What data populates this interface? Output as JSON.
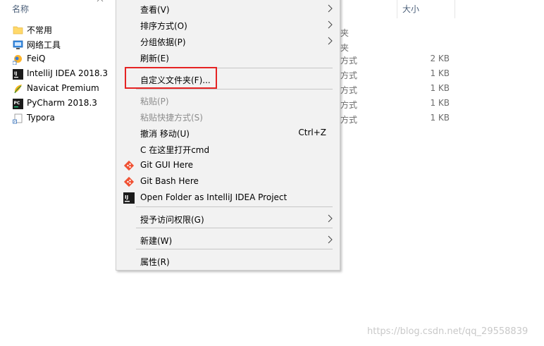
{
  "explorer": {
    "columns": {
      "name": "名称",
      "size": "大小"
    },
    "files": [
      {
        "name": "不常用",
        "icon": "folder-icon",
        "type": "",
        "size": ""
      },
      {
        "name": "网络工具",
        "icon": "network-tools-icon",
        "type": "",
        "size": ""
      },
      {
        "name": "FeiQ",
        "icon": "feiq-shortcut-icon",
        "type": "方式",
        "size": "2 KB"
      },
      {
        "name": "IntelliJ IDEA 2018.3",
        "icon": "intellij-idea-icon",
        "type": "方式",
        "size": "1 KB"
      },
      {
        "name": "Navicat Premium",
        "icon": "navicat-icon",
        "type": "方式",
        "size": "1 KB"
      },
      {
        "name": "PyCharm 2018.3",
        "icon": "pycharm-icon",
        "type": "方式",
        "size": "1 KB"
      },
      {
        "name": "Typora",
        "icon": "typora-icon",
        "type": "方式",
        "size": "1 KB"
      }
    ],
    "partial_type_fragments": [
      "夹",
      "夹"
    ]
  },
  "context_menu": {
    "view": "查看(V)",
    "sort_by": "排序方式(O)",
    "group_by": "分组依据(P)",
    "refresh": "刷新(E)",
    "customize_folder": "自定义文件夹(F)...",
    "paste": "粘贴(P)",
    "paste_shortcut": "粘贴快捷方式(S)",
    "undo_move": "撤消 移动(U)",
    "undo_shortcut": "Ctrl+Z",
    "open_cmd": "C 在这里打开cmd",
    "git_gui": "Git GUI Here",
    "git_bash": "Git Bash Here",
    "open_intellij": "Open Folder as IntelliJ IDEA Project",
    "give_access": "授予访问权限(G)",
    "new": "新建(W)",
    "properties": "属性(R)"
  },
  "watermark": "https://blog.csdn.net/qq_29558839"
}
